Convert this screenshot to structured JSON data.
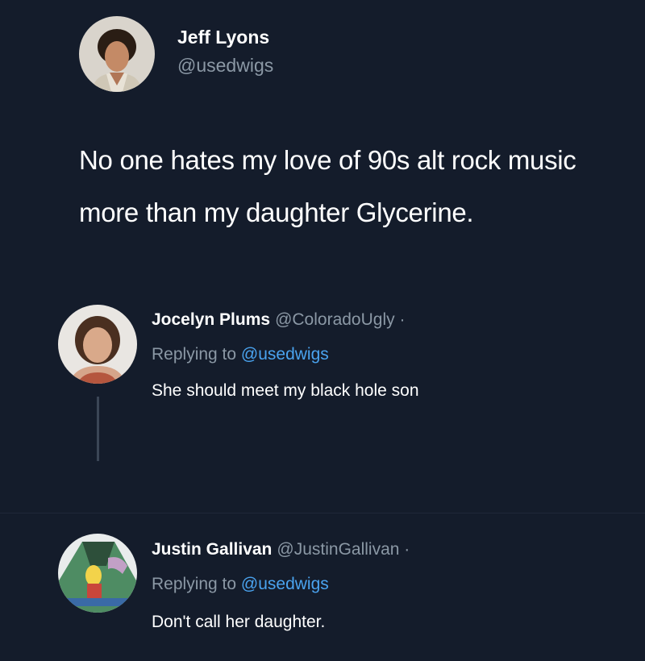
{
  "tweet": {
    "author_name": "Jeff Lyons",
    "author_handle": "@usedwigs",
    "text": "No one hates my love of 90s alt rock music more than my daughter Glycerine."
  },
  "replies": [
    {
      "name": "Jocelyn Plums",
      "handle": "@ColoradoUgly ·",
      "replying_prefix": "Replying to ",
      "replying_mention": "@usedwigs",
      "text": "She should meet my black hole son"
    },
    {
      "name": "Justin Gallivan",
      "handle": "@JustinGallivan ·",
      "replying_prefix": "Replying to ",
      "replying_mention": "@usedwigs",
      "text": "Don't call her daughter."
    }
  ],
  "colors": {
    "background": "#141c2b",
    "text": "#ffffff",
    "secondary": "#8b98a5",
    "mention": "#4aa3ef"
  }
}
